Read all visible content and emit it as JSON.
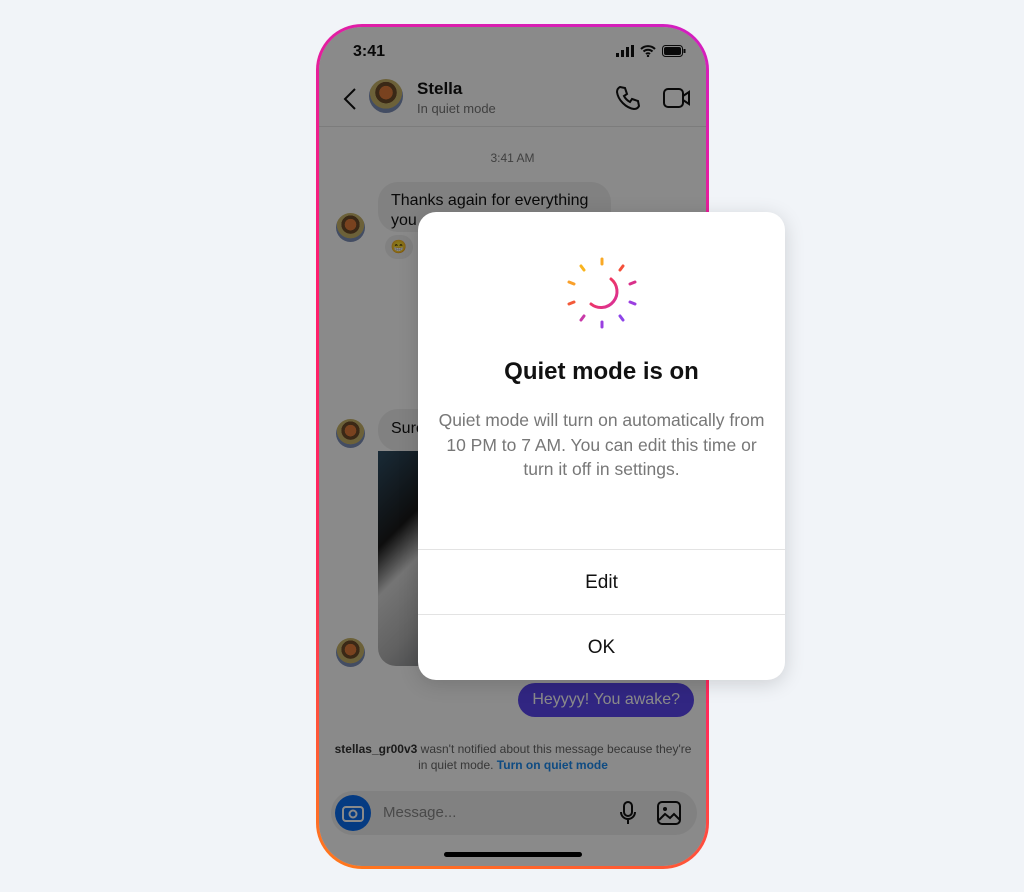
{
  "status": {
    "time": "3:41"
  },
  "header": {
    "name": "Stella",
    "subtitle": "In quiet mode"
  },
  "chat": {
    "timestamp": "3:41 AM",
    "messages": [
      {
        "from": "Stella",
        "text_line1": "Thanks again for everything",
        "text_line2": "you",
        "reaction": "😁"
      },
      {
        "from": "Stella",
        "text": "Sure"
      },
      {
        "from": "me",
        "text": "Heyyyy! You awake?"
      }
    ],
    "notice": {
      "username": "stellas_gr00v3",
      "text": " wasn't notified about this message because they're in quiet mode. ",
      "link": "Turn on quiet mode"
    }
  },
  "composer": {
    "placeholder": "Message..."
  },
  "dialog": {
    "icon": "moon-sun-icon",
    "title": "Quiet mode is on",
    "body": "Quiet mode will turn on automatically from 10 PM to 7 AM. You can edit this time or turn it off in settings.",
    "buttons": [
      "Edit",
      "OK"
    ]
  },
  "colors": {
    "sent_bubble": "#5b46f0",
    "link": "#1d8bf0",
    "frame_gradient": [
      "#d11fc2",
      "#ff1d6e",
      "#ff7a1a"
    ]
  }
}
